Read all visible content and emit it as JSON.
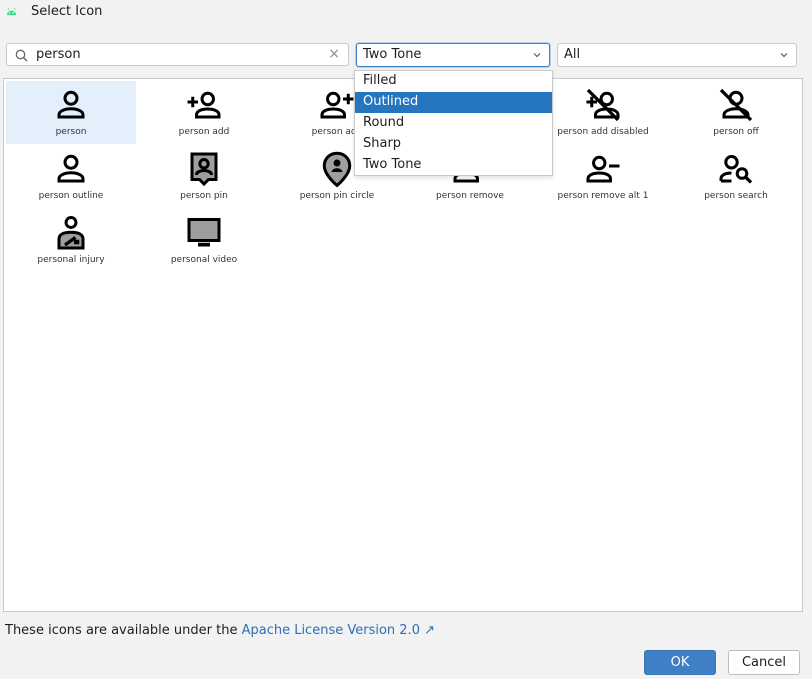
{
  "window": {
    "title": "Select Icon"
  },
  "search": {
    "value": "person",
    "clear": "×"
  },
  "style_select": {
    "selected": "Two Tone",
    "options": [
      "Filled",
      "Outlined",
      "Round",
      "Sharp",
      "Two Tone"
    ],
    "highlighted": "Outlined"
  },
  "category_select": {
    "selected": "All"
  },
  "icons": [
    {
      "label": "person",
      "icon": "person-icon",
      "selected": true
    },
    {
      "label": "person add",
      "icon": "person-add-icon"
    },
    {
      "label": "person add",
      "icon": "person-add-alt-icon"
    },
    {
      "label": "person add disabled",
      "icon": "person-add-disabled-icon"
    },
    {
      "label": "person off",
      "icon": "person-off-icon"
    },
    {
      "label": "person outline",
      "icon": "person-outline-icon"
    },
    {
      "label": "person pin",
      "icon": "person-pin-icon"
    },
    {
      "label": "person pin circle",
      "icon": "person-pin-circle-icon"
    },
    {
      "label": "person remove",
      "icon": "person-remove-icon"
    },
    {
      "label": "person remove alt 1",
      "icon": "person-remove-alt-icon"
    },
    {
      "label": "person search",
      "icon": "person-search-icon"
    },
    {
      "label": "personal injury",
      "icon": "personal-injury-icon"
    },
    {
      "label": "personal video",
      "icon": "personal-video-icon"
    }
  ],
  "footer": {
    "text": "These icons are available under the ",
    "link": "Apache License Version 2.0",
    "link_icon": "↗"
  },
  "buttons": {
    "ok": "OK",
    "cancel": "Cancel"
  },
  "colors": {
    "accent": "#2675bf",
    "selection": "#e3effb",
    "link": "#2c70b8"
  }
}
